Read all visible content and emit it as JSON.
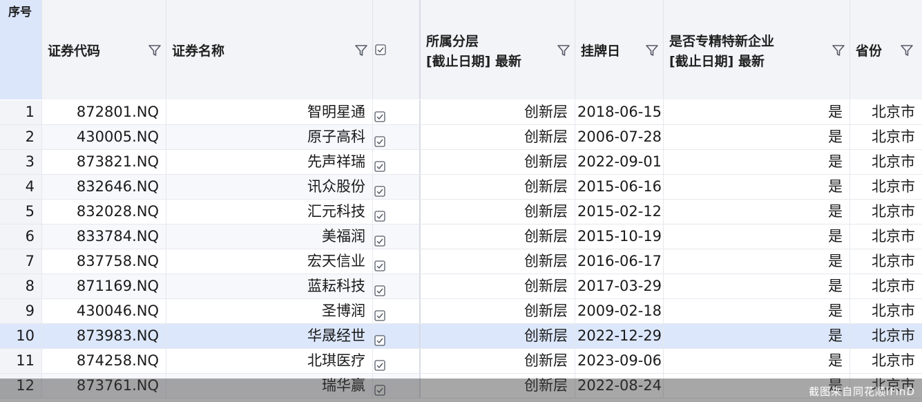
{
  "header": {
    "seq": "序号",
    "code": "证券代码",
    "name": "证券名称",
    "layer_line1": "所属分层",
    "layer_line2": "[截止日期] 最新",
    "list_date": "挂牌日",
    "sme_line1": "是否专精特新企业",
    "sme_line2": "[截止日期] 最新",
    "province": "省份"
  },
  "rows": [
    {
      "seq": "1",
      "code": "872801.NQ",
      "name": "智明星通",
      "layer": "创新层",
      "date": "2018-06-15",
      "sme": "是",
      "province": "北京市"
    },
    {
      "seq": "2",
      "code": "430005.NQ",
      "name": "原子高科",
      "layer": "创新层",
      "date": "2006-07-28",
      "sme": "是",
      "province": "北京市"
    },
    {
      "seq": "3",
      "code": "873821.NQ",
      "name": "先声祥瑞",
      "layer": "创新层",
      "date": "2022-09-01",
      "sme": "是",
      "province": "北京市"
    },
    {
      "seq": "4",
      "code": "832646.NQ",
      "name": "讯众股份",
      "layer": "创新层",
      "date": "2015-06-16",
      "sme": "是",
      "province": "北京市"
    },
    {
      "seq": "5",
      "code": "832028.NQ",
      "name": "汇元科技",
      "layer": "创新层",
      "date": "2015-02-12",
      "sme": "是",
      "province": "北京市"
    },
    {
      "seq": "6",
      "code": "833784.NQ",
      "name": "美福润",
      "layer": "创新层",
      "date": "2015-10-19",
      "sme": "是",
      "province": "北京市"
    },
    {
      "seq": "7",
      "code": "837758.NQ",
      "name": "宏天信业",
      "layer": "创新层",
      "date": "2016-06-17",
      "sme": "是",
      "province": "北京市"
    },
    {
      "seq": "8",
      "code": "871169.NQ",
      "name": "蓝耘科技",
      "layer": "创新层",
      "date": "2017-03-29",
      "sme": "是",
      "province": "北京市"
    },
    {
      "seq": "9",
      "code": "430046.NQ",
      "name": "圣博润",
      "layer": "创新层",
      "date": "2009-02-18",
      "sme": "是",
      "province": "北京市"
    },
    {
      "seq": "10",
      "code": "873983.NQ",
      "name": "华晟经世",
      "layer": "创新层",
      "date": "2022-12-29",
      "sme": "是",
      "province": "北京市"
    },
    {
      "seq": "11",
      "code": "874258.NQ",
      "name": "北琪医疗",
      "layer": "创新层",
      "date": "2023-09-06",
      "sme": "是",
      "province": "北京市"
    },
    {
      "seq": "12",
      "code": "873761.NQ",
      "name": "瑞华赢",
      "layer": "创新层",
      "date": "2022-08-24",
      "sme": "是",
      "province": "北京市"
    }
  ],
  "selected_row": "10",
  "watermark": "截图来自同花顺iFinD",
  "icons": {
    "filter": "filter-icon",
    "checkbox": "checkbox-checked-icon"
  },
  "colors": {
    "header_bg": "#f3f4f8",
    "seq_header_bg": "#dbe6fb",
    "selected_row_bg": "#dce7fb",
    "filter_icon": "#555a66"
  }
}
